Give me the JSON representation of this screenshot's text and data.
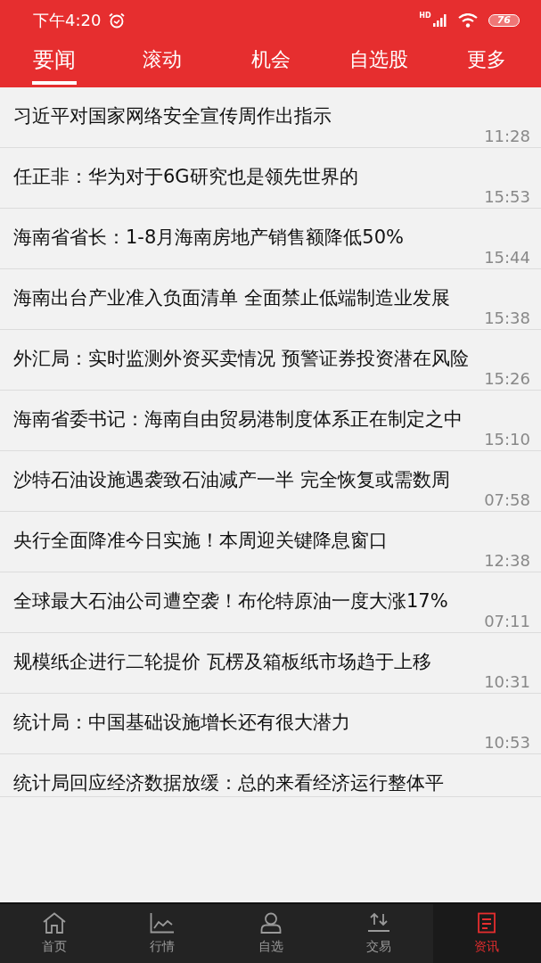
{
  "status_bar": {
    "time": "下午4:20",
    "network": "HD",
    "battery": "76"
  },
  "tabs": [
    {
      "label": "要闻",
      "selected": true
    },
    {
      "label": "滚动",
      "selected": false
    },
    {
      "label": "机会",
      "selected": false
    },
    {
      "label": "自选股",
      "selected": false
    },
    {
      "label": "更多",
      "selected": false
    }
  ],
  "news": [
    {
      "title": "习近平对国家网络安全宣传周作出指示",
      "time": "11:28"
    },
    {
      "title": "任正非：华为对于6G研究也是领先世界的",
      "time": "15:53"
    },
    {
      "title": "海南省省长：1-8月海南房地产销售额降低50%",
      "time": "15:44"
    },
    {
      "title": "海南出台产业准入负面清单 全面禁止低端制造业发展",
      "time": "15:38"
    },
    {
      "title": "外汇局：实时监测外资买卖情况 预警证券投资潜在风险",
      "time": "15:26"
    },
    {
      "title": "海南省委书记：海南自由贸易港制度体系正在制定之中",
      "time": "15:10"
    },
    {
      "title": "沙特石油设施遇袭致石油减产一半 完全恢复或需数周",
      "time": "07:58"
    },
    {
      "title": "央行全面降准今日实施！本周迎关键降息窗口",
      "time": "12:38"
    },
    {
      "title": "全球最大石油公司遭空袭！布伦特原油一度大涨17%",
      "time": "07:11"
    },
    {
      "title": "规模纸企进行二轮提价 瓦楞及箱板纸市场趋于上移",
      "time": "10:31"
    },
    {
      "title": "统计局：中国基础设施增长还有很大潜力",
      "time": "10:53"
    },
    {
      "title": "统计局回应经济数据放缓：总的来看经济运行整体平"
    }
  ],
  "bottom_nav": [
    {
      "label": "首页",
      "selected": false
    },
    {
      "label": "行情",
      "selected": false
    },
    {
      "label": "自选",
      "selected": false
    },
    {
      "label": "交易",
      "selected": false
    },
    {
      "label": "资讯",
      "selected": true
    }
  ]
}
